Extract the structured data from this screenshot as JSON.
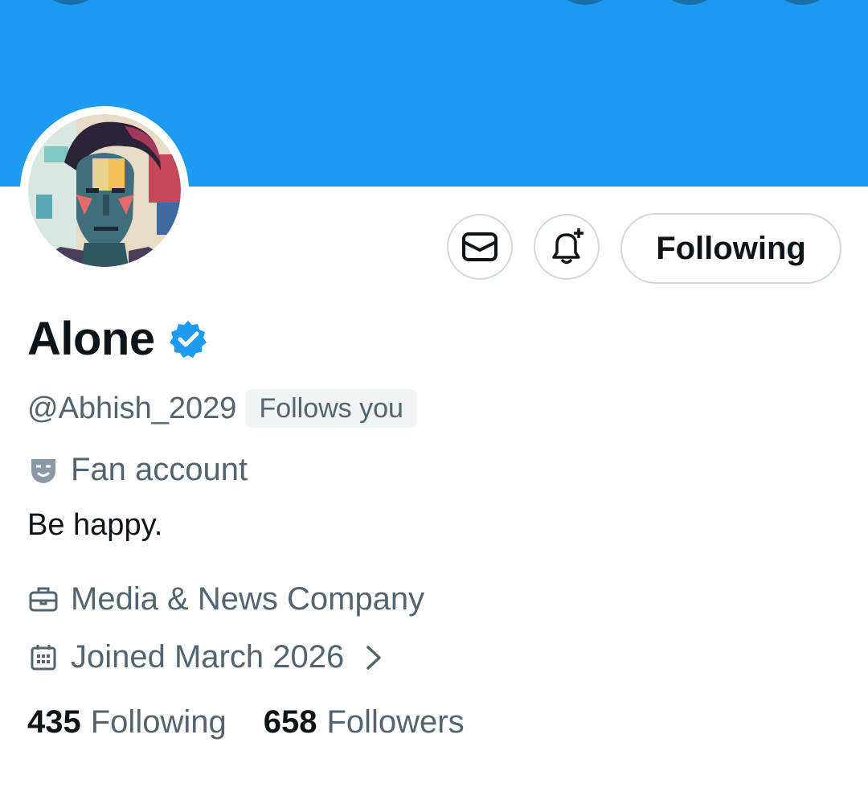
{
  "profile": {
    "name": "Alone",
    "handle": "@Abhish_2029",
    "follows_you": "Follows you",
    "category_label": "Fan account",
    "bio": "Be happy.",
    "professional_category": "Media & News Company",
    "joined": "Joined March 2026",
    "verified": true
  },
  "actions": {
    "following_button": "Following",
    "message_icon": "envelope-icon",
    "notify_icon": "bell-plus-icon"
  },
  "stats": {
    "following_count": "435",
    "following_label": "Following",
    "followers_count": "658",
    "followers_label": "Followers"
  },
  "colors": {
    "banner": "#1d9bf0",
    "verified_badge": "#1d9bf0",
    "secondary_text": "#536471",
    "primary_text": "#0f1419",
    "button_border": "#cfd9de",
    "badge_bg": "#eff3f4"
  }
}
